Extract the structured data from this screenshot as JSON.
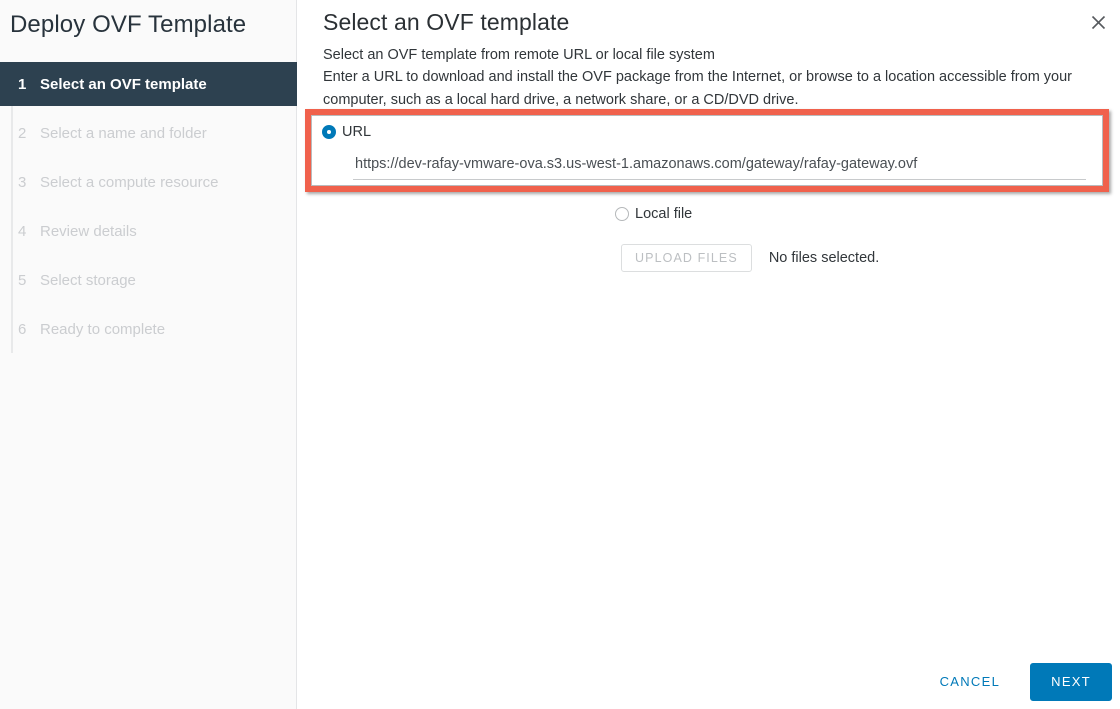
{
  "window": {
    "title": "Deploy OVF Template",
    "close_icon": "close-icon"
  },
  "sidebar": {
    "steps": [
      {
        "num": "1",
        "label": "Select an OVF template",
        "active": true
      },
      {
        "num": "2",
        "label": "Select a name and folder",
        "active": false
      },
      {
        "num": "3",
        "label": "Select a compute resource",
        "active": false
      },
      {
        "num": "4",
        "label": "Review details",
        "active": false
      },
      {
        "num": "5",
        "label": "Select storage",
        "active": false
      },
      {
        "num": "6",
        "label": "Ready to complete",
        "active": false
      }
    ]
  },
  "main": {
    "heading": "Select an OVF template",
    "subtitle": "Select an OVF template from remote URL or local file system",
    "description": "Enter a URL to download and install the OVF package from the Internet, or browse to a location accessible from your computer, such as a local hard drive, a network share, or a CD/DVD drive.",
    "source": {
      "url_option_label": "URL",
      "url_selected": true,
      "url_value": "https://dev-rafay-vmware-ova.s3.us-west-1.amazonaws.com/gateway/rafay-gateway.ovf",
      "url_placeholder": "",
      "local_file_option_label": "Local file",
      "local_file_selected": false,
      "upload_button_label": "UPLOAD FILES",
      "upload_button_disabled": true,
      "no_files_text": "No files selected."
    },
    "highlight_color": "#f0614c"
  },
  "footer": {
    "cancel_label": "CANCEL",
    "next_label": "NEXT",
    "accent_color": "#0079b8"
  }
}
